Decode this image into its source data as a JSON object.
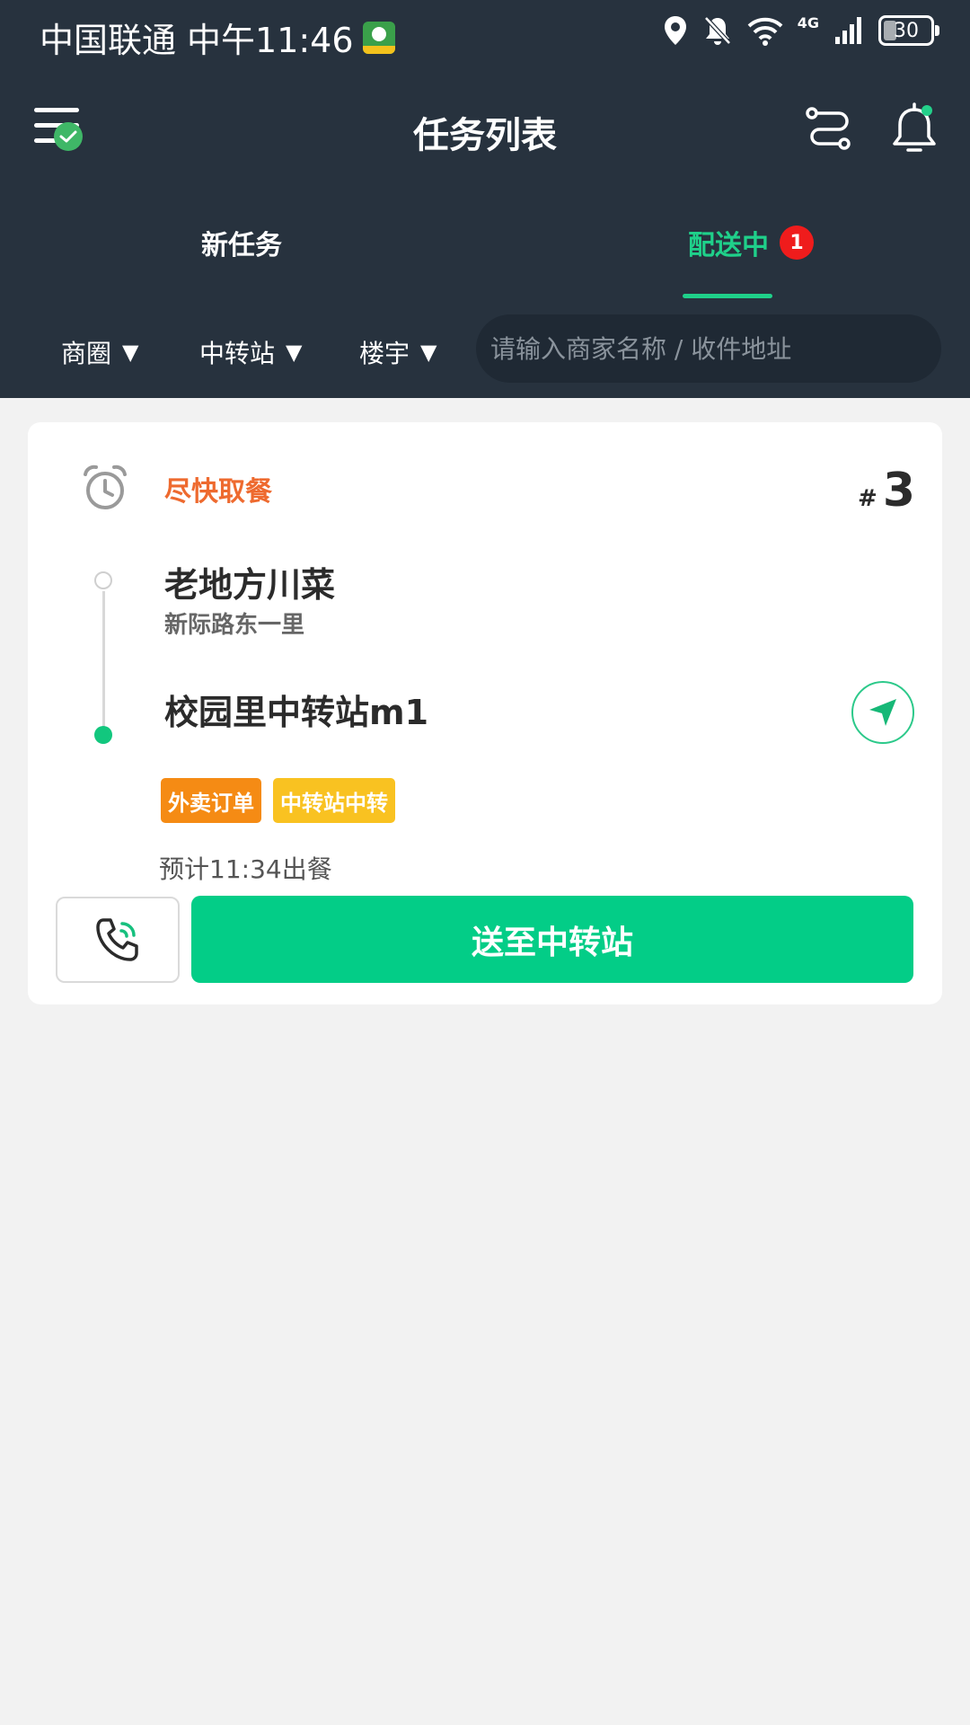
{
  "status_bar": {
    "carrier": "中国联通",
    "time": "中午11:46",
    "network": "4G",
    "battery": "30"
  },
  "header": {
    "title": "任务列表"
  },
  "tabs": [
    {
      "label": "新任务",
      "active": false
    },
    {
      "label": "配送中",
      "active": true,
      "badge": "1"
    }
  ],
  "filters": [
    {
      "label": "商圈"
    },
    {
      "label": "中转站"
    },
    {
      "label": "楼宇"
    }
  ],
  "search": {
    "placeholder": "请输入商家名称 / 收件地址"
  },
  "task": {
    "urgency": "尽快取餐",
    "hash": "#",
    "order_number": "3",
    "merchant_name": "老地方川菜",
    "merchant_address": "新际路东一里",
    "destination": "校园里中转站m1",
    "tags": [
      "外卖订单",
      "中转站中转"
    ],
    "eta": "预计11:34出餐",
    "action_label": "送至中转站"
  },
  "colors": {
    "header_bg": "#27323e",
    "accent_green": "#03cd87",
    "urgency_orange": "#ee6a2f",
    "badge_red": "#ef1c1c",
    "tag_orange": "#f58b14",
    "tag_yellow": "#f9c221"
  },
  "icons": [
    "menu-icon",
    "check-icon",
    "route-icon",
    "bell-icon",
    "alarm-clock-icon",
    "navigate-icon",
    "phone-icon",
    "location-icon",
    "mute-icon",
    "wifi-icon",
    "signal-icon"
  ]
}
